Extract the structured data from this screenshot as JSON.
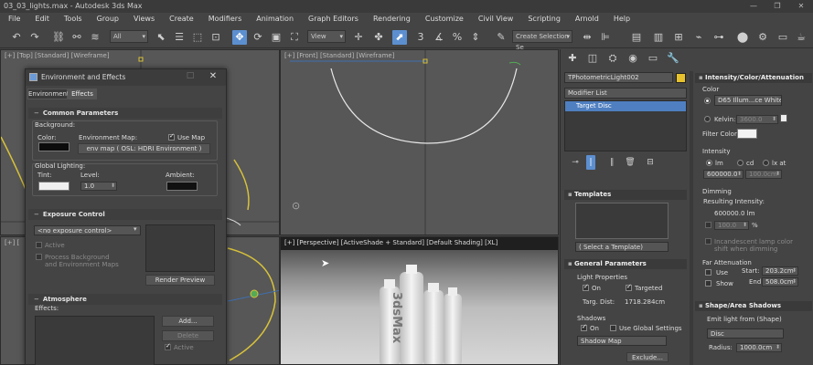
{
  "window": {
    "title": "03_03_lights.max - Autodesk 3ds Max",
    "minimize": "—",
    "maximize": "❐",
    "close": "✕"
  },
  "menu": [
    "File",
    "Edit",
    "Tools",
    "Group",
    "Views",
    "Create",
    "Modifiers",
    "Animation",
    "Graph Editors",
    "Rendering",
    "Customize",
    "Civil View",
    "Scripting",
    "Arnold",
    "Help"
  ],
  "toolbar": {
    "filter_dropdown": "All",
    "refcoord_dropdown": "View",
    "selection_set": "Create Selection Se"
  },
  "viewports": {
    "top": "[+] [Top] [Standard] [Wireframe]",
    "front": "[+] [Front] [Standard] [Wireframe]",
    "perspective": "[+] [Perspective] [ActiveShade + Standard] [Default Shading] [XL]",
    "bottom_left": "[+] ["
  },
  "product_text": "3dsMax",
  "env_dialog": {
    "title": "Environment and Effects",
    "tabs": [
      "Environment",
      "Effects"
    ],
    "common": {
      "header": "Common Parameters",
      "background": "Background:",
      "color": "Color:",
      "env_map": "Environment Map:",
      "use_map": "Use Map",
      "map_button": "env map  ( OSL: HDRI Environment )",
      "global_lighting": "Global Lighting:",
      "tint": "Tint:",
      "level": "Level:",
      "level_value": "1.0",
      "ambient": "Ambient:"
    },
    "exposure": {
      "header": "Exposure Control",
      "dropdown": "<no exposure control>",
      "active": "Active",
      "process_bg_1": "Process Background",
      "process_bg_2": "and Environment Maps",
      "render_preview": "Render Preview"
    },
    "atmosphere": {
      "header": "Atmosphere",
      "effects": "Effects:",
      "add": "Add...",
      "delete": "Delete",
      "active": "Active"
    }
  },
  "command_panel": {
    "object_name": "TPhotometricLight002",
    "modifier_list": "Modifier List",
    "stack_item": "Target Disc",
    "templates": {
      "header": "Templates",
      "select": "( Select a Template)"
    },
    "general": {
      "header": "General Parameters",
      "light_props": "Light Properties",
      "on": "On",
      "targeted": "Targeted",
      "targ_dist_label": "Targ. Dist:",
      "targ_dist": "1718.284cm",
      "shadows": "Shadows",
      "use_global": "Use Global Settings",
      "shadow_type": "Shadow Map",
      "exclude": "Exclude..."
    },
    "intensity": {
      "header": "Intensity/Color/Attenuation",
      "color": "Color",
      "d65": "D65 Illum...ce White)",
      "kelvin": "Kelvin:",
      "kelvin_value": "3600.0",
      "filter_color": "Filter Color:",
      "intensity": "Intensity",
      "lm": "lm",
      "cd": "cd",
      "lxat": "lx at",
      "lm_value": "600000.0",
      "cd_value": "100.0cm",
      "dimming": "Dimming",
      "resulting": "Resulting Intensity:",
      "resulting_value": "600000.0 lm",
      "percent_value": "100.0",
      "percent": "%",
      "incandescent_1": "Incandescent lamp color",
      "incandescent_2": "shift when dimming",
      "far_atten": "Far Attenuation",
      "use": "Use",
      "show": "Show",
      "start_label": "Start:",
      "start": "203.2cm",
      "end_label": "End:",
      "end": "508.0cm"
    },
    "shadows": {
      "header": "Shape/Area Shadows",
      "emit": "Emit light from (Shape)",
      "shape": "Disc",
      "radius_label": "Radius:",
      "radius": "1000.0cm"
    }
  },
  "colors": {
    "accent_blue": "#5c8fd0",
    "selection_blue": "#4f7fc0",
    "object_swatch_yellow": "#e8c22c"
  }
}
